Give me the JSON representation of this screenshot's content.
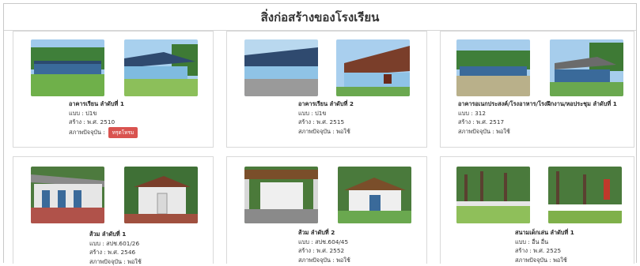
{
  "page": {
    "title": "สิ่งก่อสร้างของโรงเรียน"
  },
  "cards": [
    {
      "name": "อาคารเรียน ลำดับที่ 1",
      "type": "แบบ : ป1ข",
      "built": "สร้าง : พ.ศ. 2510",
      "status_label": "สภาพปัจจุบัน :",
      "status": "ทรุดโทรม",
      "status_is_button": true
    },
    {
      "name": "อาคารเรียน ลำดับที่ 2",
      "type": "แบบ : ป1ข",
      "built": "สร้าง : พ.ศ. 2515",
      "status_label": "สภาพปัจจุบัน :",
      "status": "พอใช้",
      "status_is_button": false
    },
    {
      "name": "อาคารอเนกประสงค์/โรงอาหาร/โรงฝึกงาน/หอประชุม ลำดับที่ 1",
      "type": "แบบ : 312",
      "built": "สร้าง : พ.ศ. 2517",
      "status_label": "สภาพปัจจุบัน :",
      "status": "พอใช้",
      "status_is_button": false
    },
    {
      "name": "ส้วม ลำดับที่ 1",
      "type": "แบบ : สปช.601/26",
      "built": "สร้าง : พ.ศ. 2546",
      "status_label": "สภาพปัจจุบัน :",
      "status": "พอใช้",
      "status_is_button": false
    },
    {
      "name": "ส้วม ลำดับที่ 2",
      "type": "แบบ : สปช.604/45",
      "built": "สร้าง : พ.ศ. 2552",
      "status_label": "สภาพปัจจุบัน :",
      "status": "พอใช้",
      "status_is_button": false
    },
    {
      "name": "สนามเด็กเล่น ลำดับที่ 1",
      "type": "แบบ : อื่น อื่น",
      "built": "สร้าง : พ.ศ. 2525",
      "status_label": "สภาพปัจจุบัน :",
      "status": "พอใช้",
      "status_is_button": false
    }
  ],
  "colors": {
    "repair_button": "#d9534f",
    "sky": "#9ec8ea",
    "grass": "#6aa84f",
    "roof": "#2f4f7f",
    "wall_blue": "#8fc3e6"
  }
}
